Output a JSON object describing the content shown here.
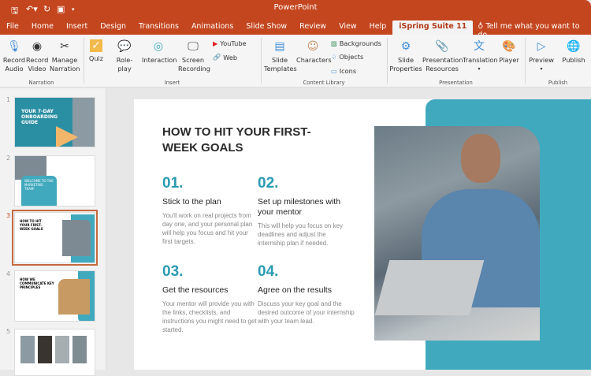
{
  "app": {
    "title": "PowerPoint"
  },
  "quick_access": [
    "save-icon",
    "undo-icon",
    "redo-icon",
    "start-from-beginning-icon",
    "customize-icon"
  ],
  "tabs": [
    "File",
    "Home",
    "Insert",
    "Design",
    "Transitions",
    "Animations",
    "Slide Show",
    "Review",
    "View",
    "Help",
    "iSpring Suite 11"
  ],
  "tell_me": "Tell me what you want to do",
  "ribbon": {
    "narration": {
      "label": "Narration",
      "buttons": [
        "Record Audio",
        "Record Video",
        "Manage Narration"
      ]
    },
    "insert": {
      "label": "Insert",
      "buttons": [
        "Quiz",
        "Role-play",
        "Interaction",
        "Screen Recording"
      ],
      "small": [
        "YouTube",
        "Web"
      ]
    },
    "content_library": {
      "label": "Content Library",
      "buttons": [
        "Slide Templates",
        "Characters"
      ],
      "small": [
        "Backgrounds",
        "Objects",
        "Icons"
      ]
    },
    "presentation": {
      "label": "Presentation",
      "buttons": [
        "Slide Properties",
        "Presentation Resources",
        "Translation",
        "Player"
      ]
    },
    "publish": {
      "label": "Publish",
      "buttons": [
        "Preview",
        "Publish"
      ]
    }
  },
  "thumbnails": [
    {
      "n": "1",
      "title": "YOUR 7-DAY ONBOARDING GUIDE"
    },
    {
      "n": "2",
      "title": "WELCOME TO THE MARKETING TEAM!"
    },
    {
      "n": "3",
      "title": "HOW TO HIT YOUR FIRST-WEEK GOALS"
    },
    {
      "n": "4",
      "title": "HOW WE COMMUNICATE KEY PRINCIPLES"
    },
    {
      "n": "5",
      "title": ""
    }
  ],
  "slide": {
    "title": "HOW TO HIT YOUR FIRST-WEEK GOALS",
    "items": [
      {
        "num": "01.",
        "title": "Stick to the plan",
        "text": "You'll work on real projects from day one, and your personal plan will help you focus and hit your first targets."
      },
      {
        "num": "02.",
        "title": "Set up milestones with your mentor",
        "text": "This will help you focus on key deadlines and adjust the internship plan if needed."
      },
      {
        "num": "03.",
        "title": "Get the resources",
        "text": "Your mentor will provide you with the links, checklists, and instructions you might need to get started."
      },
      {
        "num": "04.",
        "title": "Agree on the results",
        "text": "Discuss your key goal and the desired outcome of your internship with your team lead."
      }
    ]
  },
  "colors": {
    "brand": "#c4461f",
    "accent": "#41a9be"
  }
}
